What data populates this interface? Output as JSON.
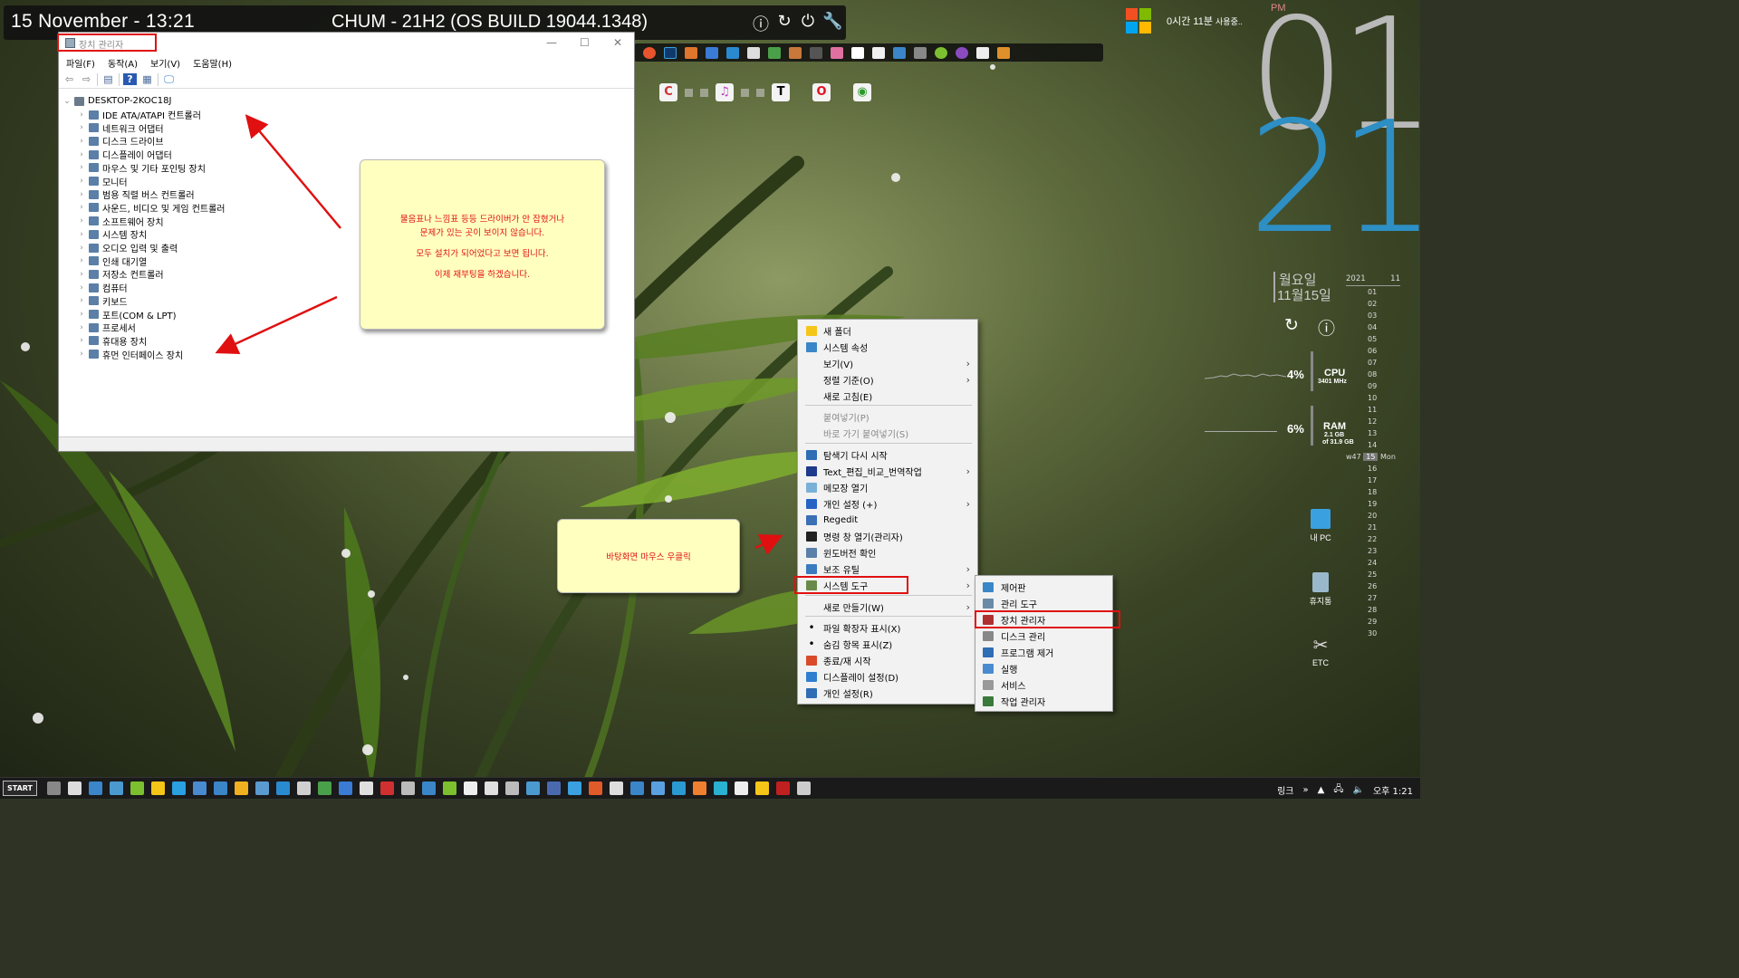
{
  "topbar": {
    "date": "15 November - 13:21",
    "title": "CHUM - 21H2 (OS BUILD 19044.1348)"
  },
  "window": {
    "title": "장치 관리자",
    "menu": [
      "파일(F)",
      "동작(A)",
      "보기(V)",
      "도움말(H)"
    ],
    "root": "DESKTOP-2KOC18J",
    "nodes": [
      "IDE ATA/ATAPI 컨트롤러",
      "네트워크 어댑터",
      "디스크 드라이브",
      "디스플레이 어댑터",
      "마우스 및 기타 포인팅 장치",
      "모니터",
      "범용 직렬 버스 컨트롤러",
      "사운드, 비디오 및 게임 컨트롤러",
      "소프트웨어 장치",
      "시스템 장치",
      "오디오 입력 및 출력",
      "인쇄 대기열",
      "저장소 컨트롤러",
      "컴퓨터",
      "키보드",
      "포트(COM & LPT)",
      "프로세서",
      "휴대용 장치",
      "휴먼 인터페이스 장치"
    ]
  },
  "notes": {
    "note1": {
      "line1": "물음표나 느낌표 등등 드라이버가 안 잡혔거나",
      "line2": "문제가 있는 곳이 보이지 않습니다.",
      "line3": "모두 설치가 되어었다고 보면 됩니다.",
      "line4": "이제 재부팅을 하겠습니다."
    },
    "note2": "바탕화면 마우스 우클릭"
  },
  "context_menu": {
    "items": [
      {
        "label": "새 폴더",
        "color": "#f5c518",
        "arrow": false,
        "disabled": false
      },
      {
        "label": "시스템 속성",
        "color": "#3a86c8",
        "arrow": false,
        "disabled": false
      },
      {
        "label": "보기(V)",
        "color": "",
        "arrow": true,
        "disabled": false
      },
      {
        "label": "정렬 기준(O)",
        "color": "",
        "arrow": true,
        "disabled": false
      },
      {
        "label": "새로 고침(E)",
        "color": "",
        "arrow": false,
        "disabled": false
      },
      {
        "label": "붙여넣기(P)",
        "color": "",
        "arrow": false,
        "disabled": true
      },
      {
        "label": "바로 가기 붙여넣기(S)",
        "color": "",
        "arrow": false,
        "disabled": true
      },
      {
        "label": "탐색기 다시 시작",
        "color": "#2f6db5",
        "arrow": false,
        "disabled": false
      },
      {
        "label": "Text_편집_비교_번역작업",
        "color": "#1e3a8a",
        "arrow": true,
        "disabled": false
      },
      {
        "label": "메모장 열기",
        "color": "#7ab0d8",
        "arrow": false,
        "disabled": false
      },
      {
        "label": "개인 설정 (+)",
        "color": "#2563c4",
        "arrow": true,
        "disabled": false
      },
      {
        "label": "Regedit",
        "color": "#3b6fb6",
        "arrow": false,
        "disabled": false
      },
      {
        "label": "명령 창 열기(관리자)",
        "color": "#222222",
        "arrow": false,
        "disabled": false
      },
      {
        "label": "윈도버전 확인",
        "color": "#5a7fa8",
        "arrow": false,
        "disabled": false
      },
      {
        "label": "보조 유틸",
        "color": "#3a7bc0",
        "arrow": true,
        "disabled": false
      },
      {
        "label": "시스템 도구",
        "color": "#6a8a4a",
        "arrow": true,
        "disabled": false
      },
      {
        "label": "새로 만들기(W)",
        "color": "",
        "arrow": true,
        "disabled": false
      },
      {
        "label": "파일 확장자 표시(X)",
        "color": "",
        "arrow": false,
        "disabled": false,
        "bullet": true
      },
      {
        "label": "숨김 항목 표시(Z)",
        "color": "",
        "arrow": false,
        "disabled": false,
        "bullet": true
      },
      {
        "label": "종료/재 시작",
        "color": "#d94a2a",
        "arrow": false,
        "disabled": false
      },
      {
        "label": "디스플레이 설정(D)",
        "color": "#2f7fd0",
        "arrow": false,
        "disabled": false
      },
      {
        "label": "개인 설정(R)",
        "color": "#2f6db5",
        "arrow": false,
        "disabled": false
      }
    ]
  },
  "submenu": {
    "items": [
      {
        "label": "제어판",
        "color": "#3a86c8"
      },
      {
        "label": "관리 도구",
        "color": "#6a8aa8"
      },
      {
        "label": "장치 관리자",
        "color": "#b03030"
      },
      {
        "label": "디스크 관리",
        "color": "#888888"
      },
      {
        "label": "프로그램 제거",
        "color": "#2f6db5"
      },
      {
        "label": "실행",
        "color": "#4a8ad0"
      },
      {
        "label": "서비스",
        "color": "#999999"
      },
      {
        "label": "작업 관리자",
        "color": "#3a7a3a"
      }
    ]
  },
  "right_panel": {
    "usage": "0시간 11분",
    "usage_suffix": "사용중..",
    "ampm": "PM",
    "hour": "01",
    "minute": "21",
    "weekday": "월요일",
    "date": "11월15일",
    "cpu_percent": "4%",
    "cpu_label": "CPU",
    "cpu_mhz": "3401 MHz",
    "ram_percent": "6%",
    "ram_label": "RAM",
    "ram_used": "2.1 GB",
    "ram_total": "of 31.9 GB",
    "cal_year": "2021",
    "cal_month": "11",
    "cal_week": "w47",
    "cal_today": "15",
    "cal_today_day": "Mon",
    "cal_days": [
      "01",
      "02",
      "03",
      "04",
      "05",
      "06",
      "07",
      "08",
      "09",
      "10",
      "11",
      "12",
      "13",
      "14",
      "15",
      "16",
      "17",
      "18",
      "19",
      "20",
      "21",
      "22",
      "23",
      "24",
      "25",
      "26",
      "27",
      "28",
      "29",
      "30"
    ]
  },
  "desktop_icons": [
    {
      "label": "내 PC",
      "color": "#3aa0e0"
    },
    {
      "label": "휴지통",
      "color": "#9ab8cc"
    },
    {
      "label": "ETC",
      "color": "#bbbbbb"
    }
  ],
  "taskbar": {
    "start": "START",
    "links": "링크",
    "time": "오후 1:21"
  }
}
